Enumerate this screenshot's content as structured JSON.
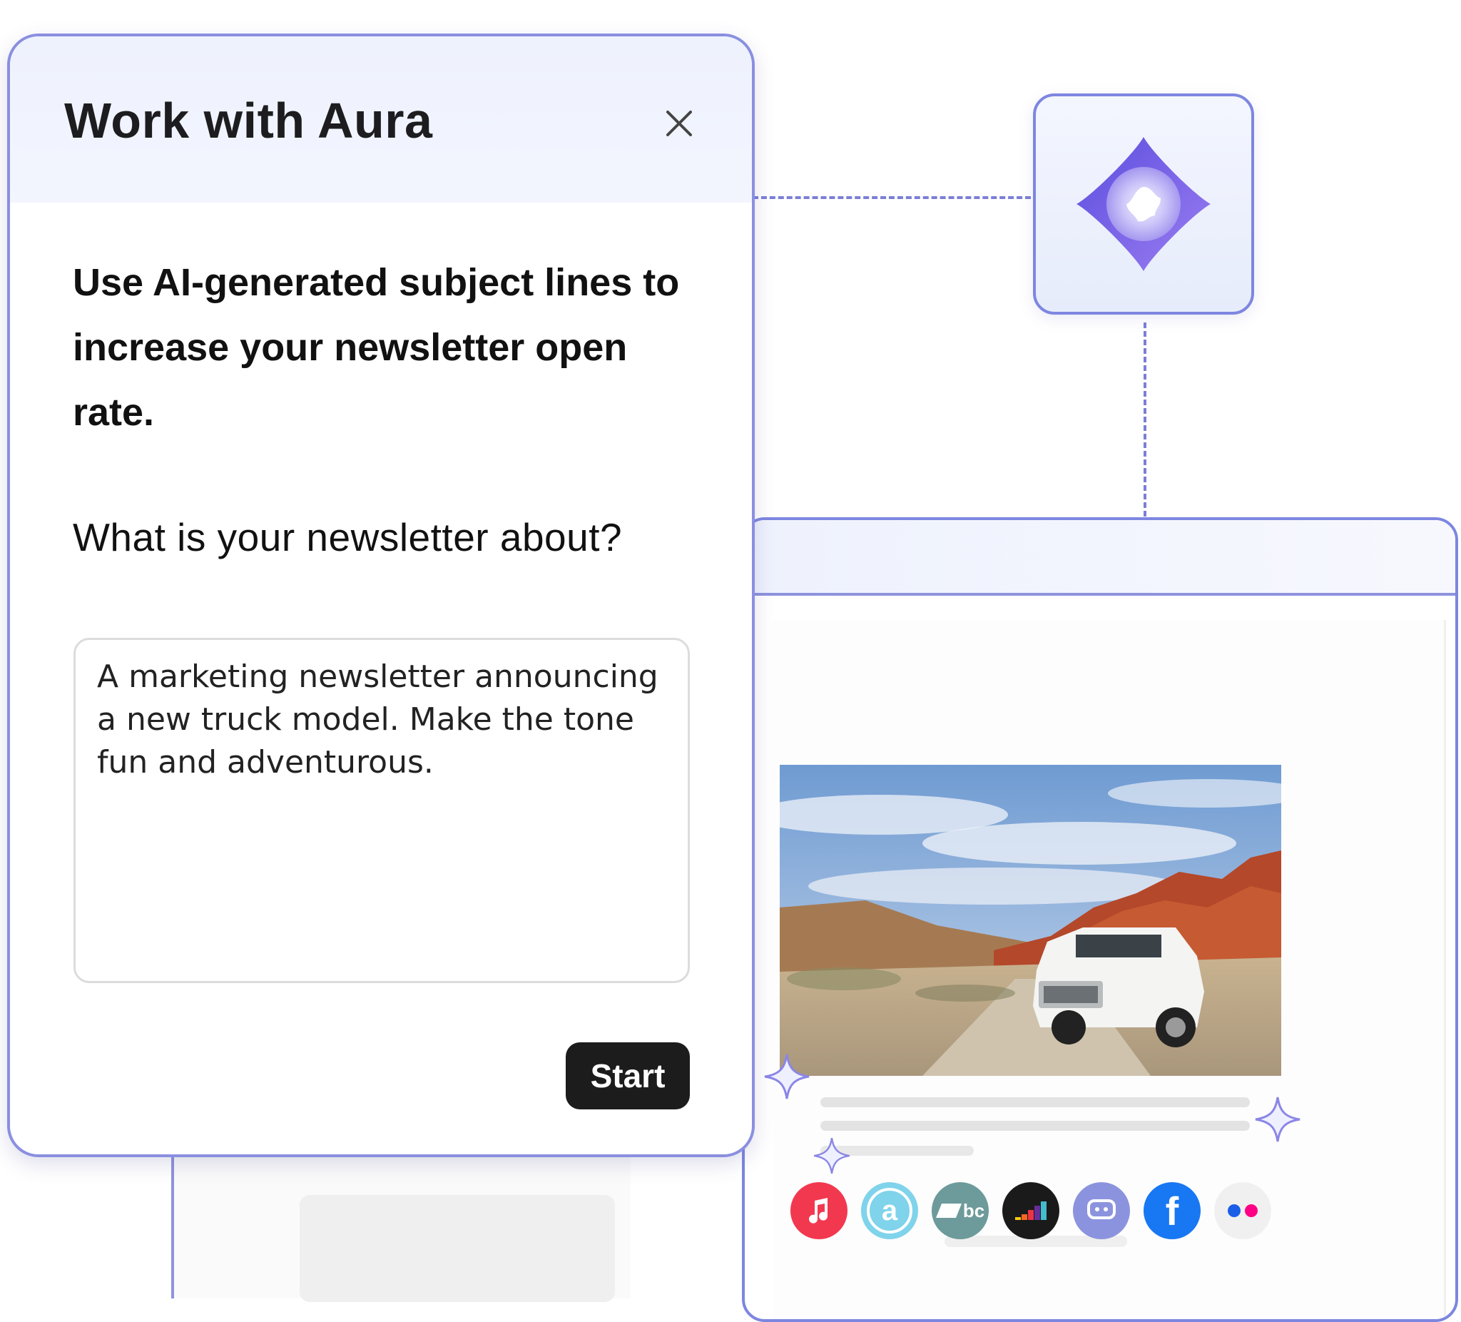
{
  "dialog": {
    "title": "Work with Aura",
    "close_icon": "close-icon",
    "headline": "Use AI-generated subject lines to increase your newsletter open rate.",
    "question": "What is your newsletter about?",
    "prompt_value": "A marketing newsletter announcing a new truck model. Make the tone fun and adventurous.",
    "start_label": "Start"
  },
  "aura": {
    "icon": "aura-logo-icon"
  },
  "preview": {
    "image": "white-suv-desert-photo",
    "social_icons": [
      "apple-music-icon",
      "audiomack-icon",
      "bandcamp-icon",
      "deezer-icon",
      "discord-icon",
      "facebook-icon",
      "flickr-icon"
    ]
  },
  "colors": {
    "accent": "#7d86e0",
    "start_button": "#1c1c1c"
  }
}
